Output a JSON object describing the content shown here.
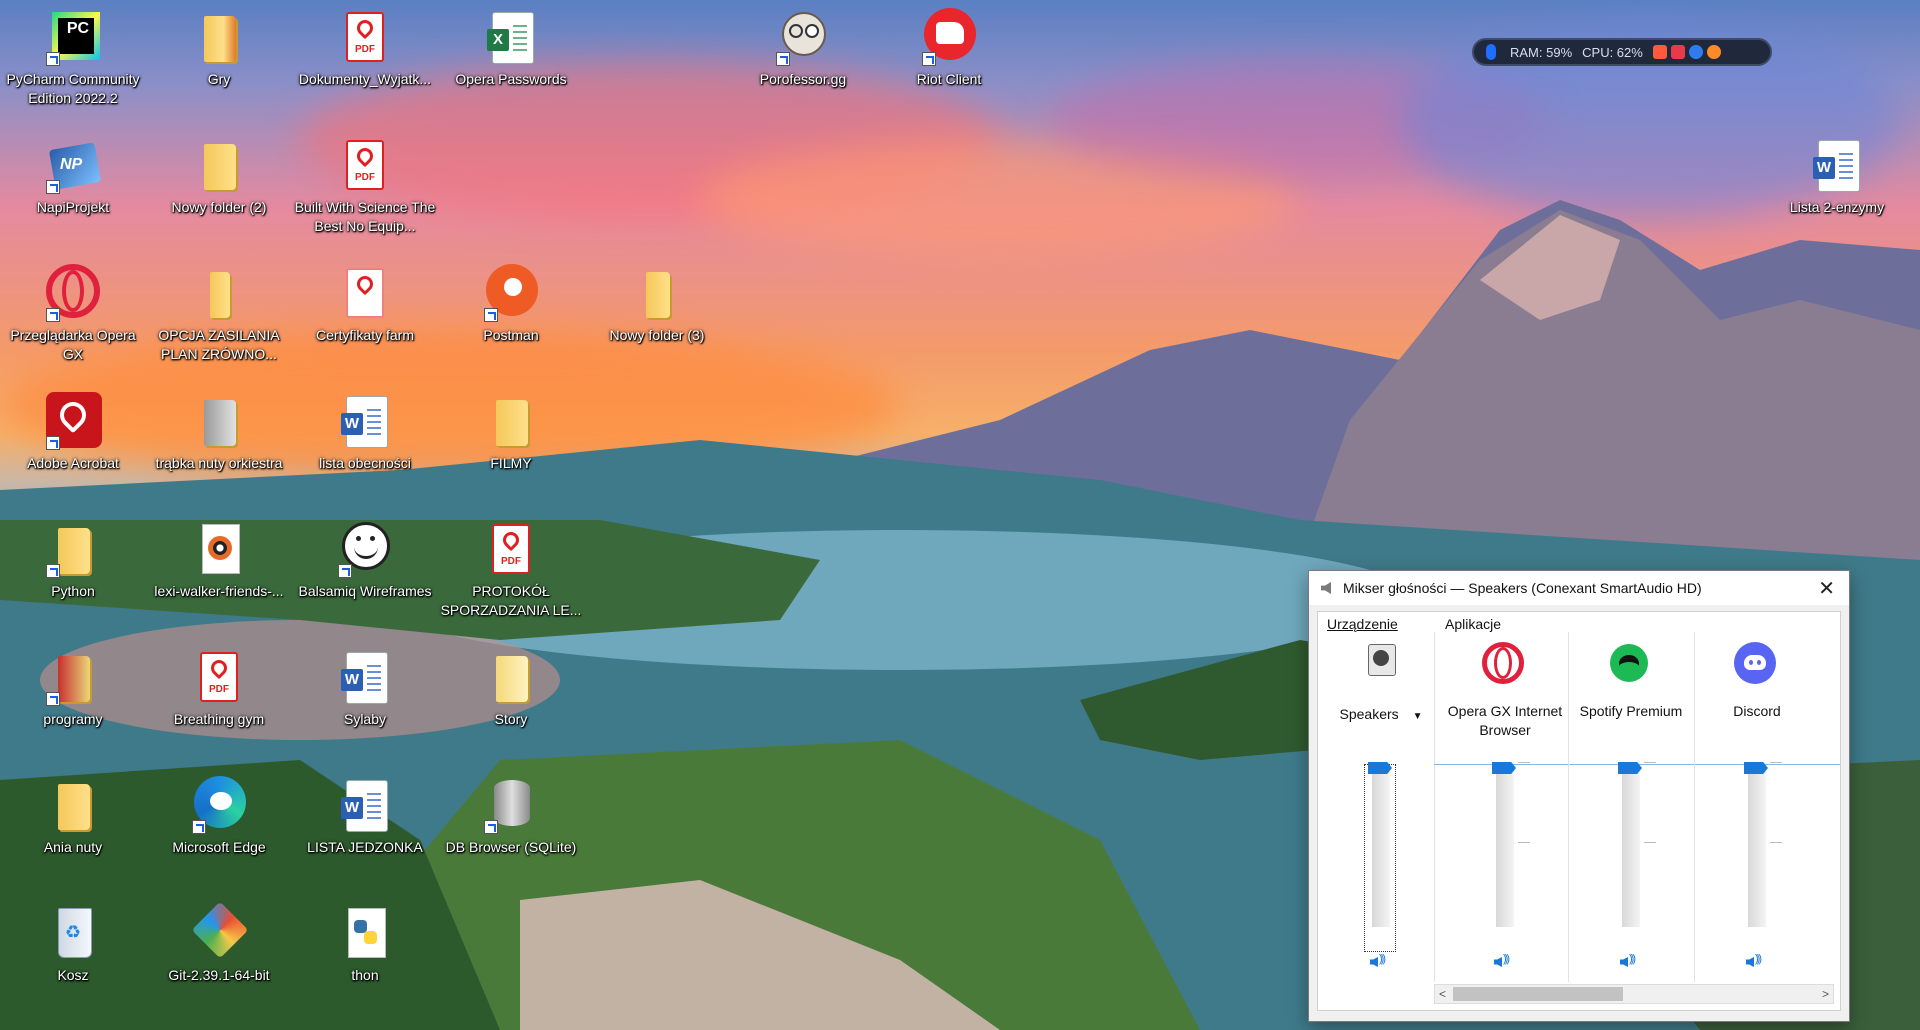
{
  "desktop": {
    "icons": [
      {
        "label": "PyCharm Community Edition 2022.2",
        "icon": "pycharm-icon"
      },
      {
        "label": "Gry",
        "icon": "folder-icon"
      },
      {
        "label": "Dokumenty_Wyjatk...",
        "icon": "pdf-icon"
      },
      {
        "label": "Opera Passwords",
        "icon": "excel-icon"
      },
      {
        "label": "Porofessor.gg",
        "icon": "porofessor-icon"
      },
      {
        "label": "Riot Client",
        "icon": "riot-icon"
      },
      {
        "label": "NapiProjekt",
        "icon": "napiprojekt-icon"
      },
      {
        "label": "Nowy folder (2)",
        "icon": "folder-icon"
      },
      {
        "label": "Built With Science The Best No Equip...",
        "icon": "pdf-icon"
      },
      {
        "label": "Przeglądarka Opera GX",
        "icon": "opera-gx-icon"
      },
      {
        "label": "OPCJA ZASILANIA PLAN ZRÓWNO...",
        "icon": "folder-icon"
      },
      {
        "label": "Certyfikaty farm",
        "icon": "pdf-icon"
      },
      {
        "label": "Postman",
        "icon": "postman-icon"
      },
      {
        "label": "Nowy folder (3)",
        "icon": "folder-icon"
      },
      {
        "label": "Adobe Acrobat",
        "icon": "acrobat-icon"
      },
      {
        "label": "trąbka nuty orkiestra",
        "icon": "archive-icon"
      },
      {
        "label": "lista obecności",
        "icon": "word-icon"
      },
      {
        "label": "FILMY",
        "icon": "folder-icon"
      },
      {
        "label": "Python",
        "icon": "folder-icon"
      },
      {
        "label": "lexi-walker-friends-...",
        "icon": "media-file-icon"
      },
      {
        "label": "Balsamiq Wireframes",
        "icon": "balsamiq-icon"
      },
      {
        "label": "PROTOKÓŁ SPORZADZANIA LE...",
        "icon": "pdf-icon"
      },
      {
        "label": "programy",
        "icon": "folder-icon"
      },
      {
        "label": "Breathing gym",
        "icon": "pdf-icon"
      },
      {
        "label": "Sylaby",
        "icon": "word-icon"
      },
      {
        "label": "Story",
        "icon": "folder-icon"
      },
      {
        "label": "Ania nuty",
        "icon": "folder-icon"
      },
      {
        "label": "Microsoft Edge",
        "icon": "edge-icon"
      },
      {
        "label": "LISTA JEDZONKA",
        "icon": "word-icon"
      },
      {
        "label": "DB Browser (SQLite)",
        "icon": "database-icon"
      },
      {
        "label": "Kosz",
        "icon": "recycle-bin-icon"
      },
      {
        "label": "Git-2.39.1-64-bit",
        "icon": "git-icon"
      },
      {
        "label": "thon",
        "icon": "python-file-icon"
      },
      {
        "label": "Lista 2-enzymy",
        "icon": "word-icon"
      }
    ]
  },
  "perf_overlay": {
    "ram": "RAM: 59%",
    "cpu": "CPU: 62%"
  },
  "mixer": {
    "title": "Mikser głośności — Speakers (Conexant SmartAudio HD)",
    "close": "✕",
    "device_group": "Urządzenie",
    "apps_group": "Aplikacje",
    "device": {
      "name": "Speakers",
      "level": 1.0
    },
    "apps": [
      {
        "name": "Opera GX Internet Browser",
        "level": 1.0,
        "color": "#e0213d"
      },
      {
        "name": "Spotify Premium",
        "level": 1.0,
        "color": "#1db954"
      },
      {
        "name": "Discord",
        "level": 1.0,
        "color": "#5865f2"
      }
    ],
    "scroll_left": "<",
    "scroll_right": ">"
  },
  "colors": {
    "accent": "#1978d8"
  }
}
